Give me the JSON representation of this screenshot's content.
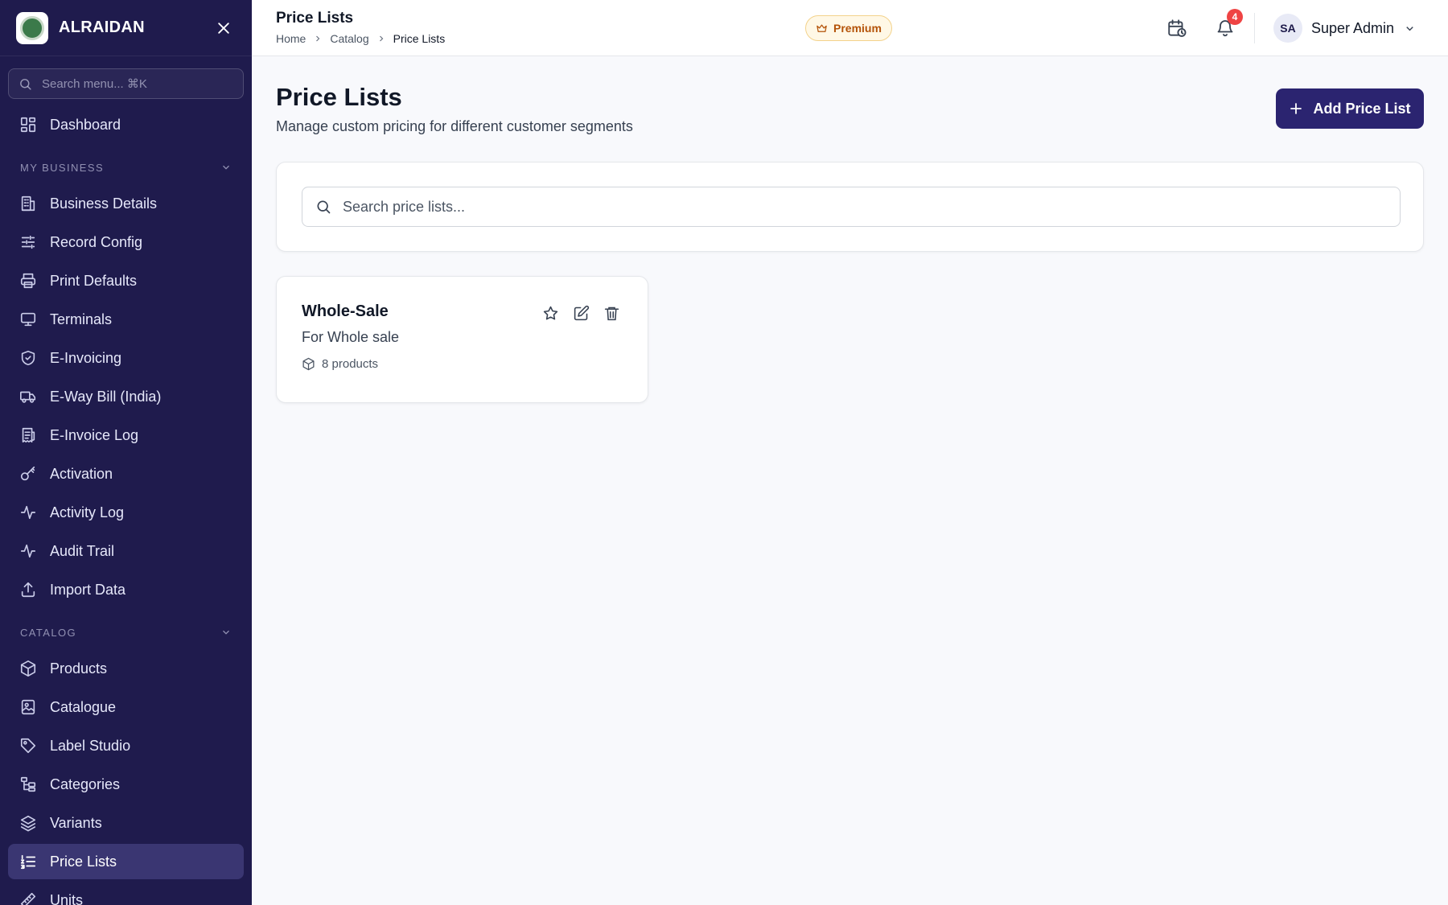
{
  "sidebar": {
    "brand": "ALRAIDAN",
    "search_placeholder": "Search menu... ⌘K",
    "dashboard": "Dashboard",
    "sections": [
      {
        "title": "MY BUSINESS",
        "items": [
          {
            "label": "Business Details",
            "icon": "building-icon"
          },
          {
            "label": "Record Config",
            "icon": "sliders-icon"
          },
          {
            "label": "Print Defaults",
            "icon": "printer-icon"
          },
          {
            "label": "Terminals",
            "icon": "monitor-icon"
          },
          {
            "label": "E-Invoicing",
            "icon": "shield-check-icon"
          },
          {
            "label": "E-Way Bill (India)",
            "icon": "truck-icon"
          },
          {
            "label": "E-Invoice Log",
            "icon": "receipt-icon"
          },
          {
            "label": "Activation",
            "icon": "key-icon"
          },
          {
            "label": "Activity Log",
            "icon": "activity-icon"
          },
          {
            "label": "Audit Trail",
            "icon": "activity-icon"
          },
          {
            "label": "Import Data",
            "icon": "upload-icon"
          }
        ]
      },
      {
        "title": "CATALOG",
        "items": [
          {
            "label": "Products",
            "icon": "box-icon"
          },
          {
            "label": "Catalogue",
            "icon": "image-book-icon"
          },
          {
            "label": "Label Studio",
            "icon": "tag-icon"
          },
          {
            "label": "Categories",
            "icon": "folder-tree-icon"
          },
          {
            "label": "Variants",
            "icon": "layers-icon"
          },
          {
            "label": "Price Lists",
            "icon": "list-ordered-icon",
            "active": true
          },
          {
            "label": "Units",
            "icon": "ruler-icon"
          }
        ]
      }
    ]
  },
  "header": {
    "title": "Price Lists",
    "breadcrumb": [
      "Home",
      "Catalog",
      "Price Lists"
    ],
    "premium_label": "Premium",
    "notification_count": "4",
    "user": {
      "initials": "SA",
      "name": "Super Admin"
    }
  },
  "main": {
    "title": "Price Lists",
    "subtitle": "Manage custom pricing for different customer segments",
    "add_button": "Add Price List",
    "search_placeholder": "Search price lists...",
    "price_lists": [
      {
        "name": "Whole-Sale",
        "description": "For Whole sale",
        "products": "8 products"
      }
    ]
  },
  "colors": {
    "sidebar_bg": "#1f1b4d",
    "sidebar_active": "#3a3672",
    "primary": "#2b2470",
    "premium": "#b45309",
    "badge": "#ef4444"
  }
}
